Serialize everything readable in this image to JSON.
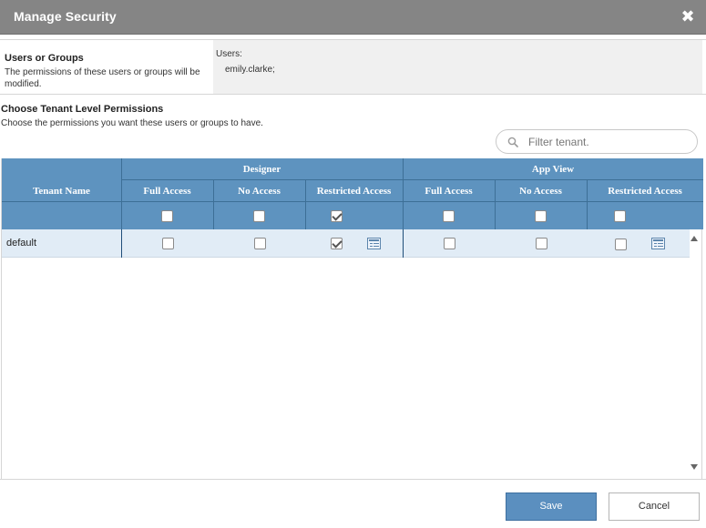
{
  "dialog": {
    "title": "Manage Security"
  },
  "users_groups": {
    "heading": "Users or Groups",
    "description": "The permissions of these users or groups will be modified.",
    "users_label": "Users:",
    "users_value": "emily.clarke;"
  },
  "permissions": {
    "heading": "Choose Tenant Level Permissions",
    "description": "Choose the permissions you want these users or groups to have."
  },
  "filter": {
    "placeholder": "Filter tenant."
  },
  "table": {
    "tenant_name_header": "Tenant Name",
    "groups": [
      {
        "label": "Designer",
        "columns": [
          "Full Access",
          "No Access",
          "Restricted Access"
        ]
      },
      {
        "label": "App View",
        "columns": [
          "Full Access",
          "No Access",
          "Restricted Access"
        ]
      }
    ],
    "select_all": {
      "designer": [
        false,
        false,
        true
      ],
      "app_view": [
        false,
        false,
        false
      ]
    },
    "rows": [
      {
        "name": "default",
        "designer": [
          false,
          false,
          true
        ],
        "app_view": [
          false,
          false,
          false
        ]
      }
    ]
  },
  "footer": {
    "save_label": "Save",
    "cancel_label": "Cancel"
  }
}
